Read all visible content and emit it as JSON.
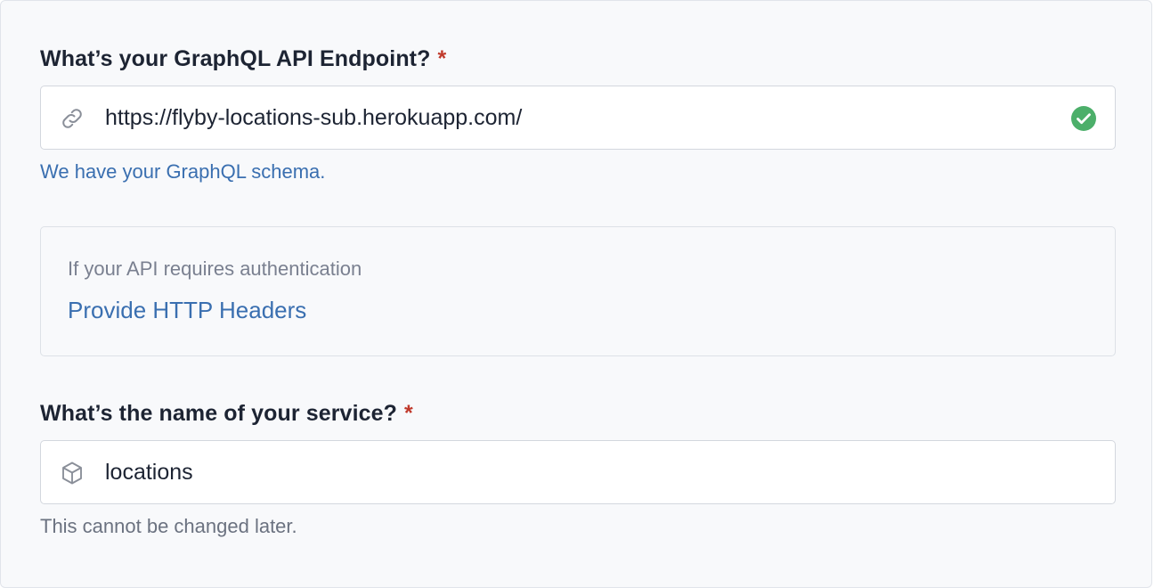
{
  "endpoint_section": {
    "label": "What’s your GraphQL API Endpoint?",
    "required_marker": "*",
    "input_value": "https://flyby-locations-sub.herokuapp.com/",
    "icon": "link-icon",
    "status_icon": "check-circle-icon",
    "status_color": "#4caf6a",
    "status_message": "We have your GraphQL schema."
  },
  "auth_section": {
    "hint": "If your API requires authentication",
    "link_label": "Provide HTTP Headers"
  },
  "service_section": {
    "label": "What’s the name of your service?",
    "required_marker": "*",
    "input_value": "locations",
    "icon": "cube-icon",
    "help_text": "This cannot be changed later."
  },
  "colors": {
    "accent_link": "#3a6fb0",
    "required": "#c0392b",
    "success": "#4caf6a"
  }
}
